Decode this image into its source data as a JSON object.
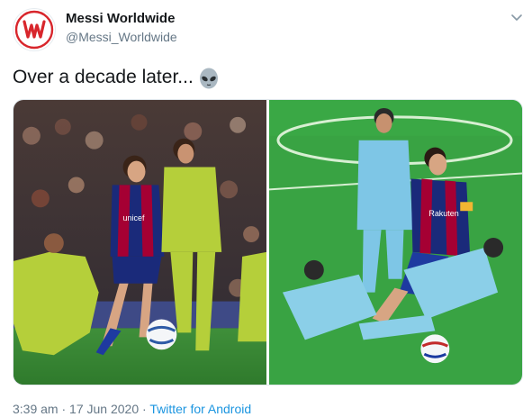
{
  "account": {
    "display_name": "Messi Worldwide",
    "handle": "@Messi_Worldwide"
  },
  "tweet": {
    "text": "Over a decade later...",
    "emoji": "alien-emoji"
  },
  "media": {
    "photos": [
      {
        "subject": "messi-young-barca-2000s"
      },
      {
        "subject": "messi-barca-2020-tackle"
      }
    ],
    "ball_brand_text": "",
    "jersey_sponsor_left": "unicef",
    "jersey_sponsor_right": "Rakuten"
  },
  "footer": {
    "time": "3:39 am",
    "separator": " · ",
    "date": "17 Jun 2020",
    "source": "Twitter for Android"
  },
  "colors": {
    "text_primary": "#14171a",
    "text_secondary": "#657786",
    "link": "#1b95e0",
    "avatar_red": "#d8262c"
  }
}
